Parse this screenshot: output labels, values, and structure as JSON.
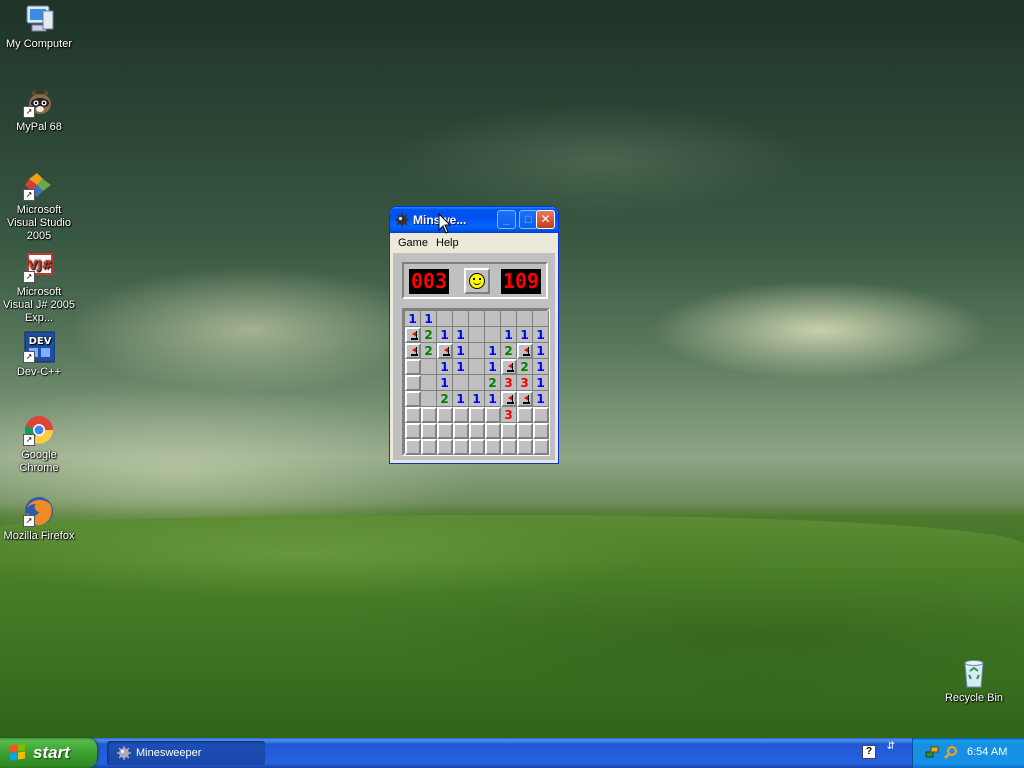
{
  "desktop": {
    "icons": [
      {
        "label": "My Computer"
      },
      {
        "label": "MyPal 68"
      },
      {
        "label": "Microsoft Visual Studio 2005"
      },
      {
        "label": "Microsoft Visual J# 2005 Exp..."
      },
      {
        "label": "Dev-C++"
      },
      {
        "label": "Google Chrome"
      },
      {
        "label": "Mozilla Firefox"
      },
      {
        "label": "Recycle Bin"
      }
    ]
  },
  "window": {
    "title": "Minesweeper",
    "title_shown": "Minswe...",
    "menu": [
      "Game",
      "Help"
    ],
    "mine_counter": "003",
    "timer": "109",
    "board": [
      [
        "1",
        "1",
        "",
        "",
        "",
        "",
        "",
        "",
        ""
      ],
      [
        "F",
        "2",
        "1",
        "1",
        "",
        "",
        "1",
        "1",
        "1"
      ],
      [
        "F",
        "2",
        "F",
        "1",
        "",
        "1",
        "2",
        "F",
        "1"
      ],
      [
        "#",
        "",
        "1",
        "1",
        "",
        "1",
        "F",
        "2",
        "1"
      ],
      [
        "#",
        "",
        "1",
        "",
        "",
        "2",
        "3",
        "3",
        "1"
      ],
      [
        "#",
        "",
        "2",
        "1",
        "1",
        "1",
        "F",
        "F",
        "1"
      ],
      [
        "#",
        "#",
        "#",
        "#",
        "#",
        "#",
        "3",
        "#",
        "#"
      ],
      [
        "#",
        "#",
        "#",
        "#",
        "#",
        "#",
        "#",
        "#",
        "#"
      ],
      [
        "#",
        "#",
        "#",
        "#",
        "#",
        "#",
        "#",
        "#",
        "#"
      ]
    ]
  },
  "taskbar": {
    "start_label": "start",
    "tasks": [
      {
        "label": "Minesweeper"
      }
    ],
    "clock": "6:54 AM"
  },
  "colors": {
    "titlebar": "#0058e6",
    "start": "#3c9f2f",
    "taskbar": "#245edb",
    "lcd": "#ff0000"
  },
  "icons": {
    "tray": [
      "help-icon",
      "network-icon",
      "security-icon",
      "search-icon"
    ],
    "window": "minesweeper-icon"
  }
}
